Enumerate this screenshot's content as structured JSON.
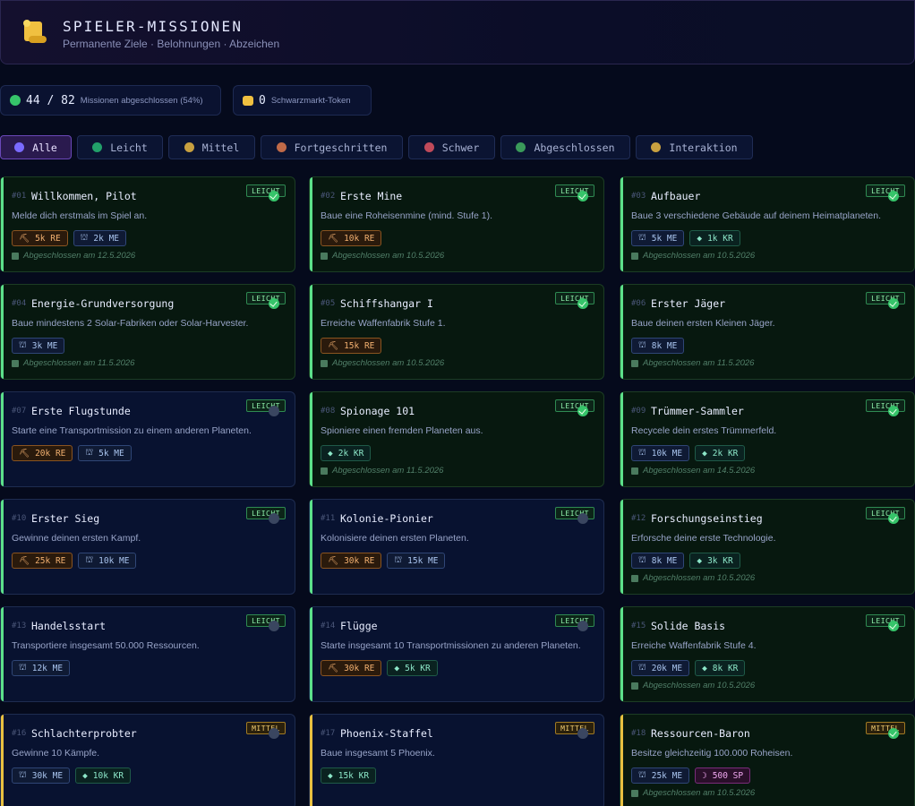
{
  "header": {
    "title": "SPIELER-MISSIONEN",
    "subtitle": "Permanente Ziele · Belohnungen · Abzeichen"
  },
  "stats": {
    "completed_value": "44 / 82",
    "completed_label": "Missionen abgeschlossen (54%)",
    "tokens_value": "0",
    "tokens_label": "Schwarzmarkt-Token"
  },
  "filters": [
    {
      "label": "Alle",
      "color": "#7a6aff"
    },
    {
      "label": "Leicht",
      "color": "#22a06a"
    },
    {
      "label": "Mittel",
      "color": "#c8a040"
    },
    {
      "label": "Fortgeschritten",
      "color": "#c06a48"
    },
    {
      "label": "Schwer",
      "color": "#c04a5a"
    },
    {
      "label": "Abgeschlossen",
      "color": "#3a9a5a"
    },
    {
      "label": "Interaktion",
      "color": "#c8a040"
    }
  ],
  "colors": {
    "leicht": "#5ce08a",
    "mittel": "#e8c040",
    "re": "#f2b070",
    "me": "#a9c4ee",
    "kr": "#8ce6c8",
    "sp": "#f0a8f0"
  },
  "missions": [
    {
      "id": "#01",
      "title": "Willkommen, Pilot",
      "desc": "Melde dich erstmals im Spiel an.",
      "badge": "LEICHT",
      "done": true,
      "rewards": [
        {
          "t": "re",
          "v": "5k RE"
        },
        {
          "t": "me",
          "v": "2k ME"
        }
      ],
      "completed": "Abgeschlossen am 12.5.2026"
    },
    {
      "id": "#02",
      "title": "Erste Mine",
      "desc": "Baue eine Roheisenmine (mind. Stufe 1).",
      "badge": "LEICHT",
      "done": true,
      "rewards": [
        {
          "t": "re",
          "v": "10k RE"
        }
      ],
      "completed": "Abgeschlossen am 10.5.2026"
    },
    {
      "id": "#03",
      "title": "Aufbauer",
      "desc": "Baue 3 verschiedene Gebäude auf deinem Heimatplaneten.",
      "badge": "LEICHT",
      "done": true,
      "rewards": [
        {
          "t": "me",
          "v": "5k ME"
        },
        {
          "t": "kr",
          "v": "1k KR"
        }
      ],
      "completed": "Abgeschlossen am 10.5.2026"
    },
    {
      "id": "#04",
      "title": "Energie-Grundversorgung",
      "desc": "Baue mindestens 2 Solar-Fabriken oder Solar-Harvester.",
      "badge": "LEICHT",
      "done": true,
      "rewards": [
        {
          "t": "me",
          "v": "3k ME"
        }
      ],
      "completed": "Abgeschlossen am 11.5.2026"
    },
    {
      "id": "#05",
      "title": "Schiffshangar I",
      "desc": "Erreiche Waffenfabrik Stufe 1.",
      "badge": "LEICHT",
      "done": true,
      "rewards": [
        {
          "t": "re",
          "v": "15k RE"
        }
      ],
      "completed": "Abgeschlossen am 10.5.2026"
    },
    {
      "id": "#06",
      "title": "Erster Jäger",
      "desc": "Baue deinen ersten Kleinen Jäger.",
      "badge": "LEICHT",
      "done": true,
      "rewards": [
        {
          "t": "me",
          "v": "8k ME"
        }
      ],
      "completed": "Abgeschlossen am 11.5.2026"
    },
    {
      "id": "#07",
      "title": "Erste Flugstunde",
      "desc": "Starte eine Transportmission zu einem anderen Planeten.",
      "badge": "LEICHT",
      "done": false,
      "rewards": [
        {
          "t": "re",
          "v": "20k RE"
        },
        {
          "t": "me",
          "v": "5k ME"
        }
      ],
      "completed": ""
    },
    {
      "id": "#08",
      "title": "Spionage 101",
      "desc": "Spioniere einen fremden Planeten aus.",
      "badge": "LEICHT",
      "done": true,
      "rewards": [
        {
          "t": "kr",
          "v": "2k KR"
        }
      ],
      "completed": "Abgeschlossen am 11.5.2026"
    },
    {
      "id": "#09",
      "title": "Trümmer-Sammler",
      "desc": "Recycele dein erstes Trümmerfeld.",
      "badge": "LEICHT",
      "done": true,
      "rewards": [
        {
          "t": "me",
          "v": "10k ME"
        },
        {
          "t": "kr",
          "v": "2k KR"
        }
      ],
      "completed": "Abgeschlossen am 14.5.2026"
    },
    {
      "id": "#10",
      "title": "Erster Sieg",
      "desc": "Gewinne deinen ersten Kampf.",
      "badge": "LEICHT",
      "done": false,
      "rewards": [
        {
          "t": "re",
          "v": "25k RE"
        },
        {
          "t": "me",
          "v": "10k ME"
        }
      ],
      "completed": ""
    },
    {
      "id": "#11",
      "title": "Kolonie-Pionier",
      "desc": "Kolonisiere deinen ersten Planeten.",
      "badge": "LEICHT",
      "done": false,
      "rewards": [
        {
          "t": "re",
          "v": "30k RE"
        },
        {
          "t": "me",
          "v": "15k ME"
        }
      ],
      "completed": ""
    },
    {
      "id": "#12",
      "title": "Forschungseinstieg",
      "desc": "Erforsche deine erste Technologie.",
      "badge": "LEICHT",
      "done": true,
      "rewards": [
        {
          "t": "me",
          "v": "8k ME"
        },
        {
          "t": "kr",
          "v": "3k KR"
        }
      ],
      "completed": "Abgeschlossen am 10.5.2026"
    },
    {
      "id": "#13",
      "title": "Handelsstart",
      "desc": "Transportiere insgesamt 50.000 Ressourcen.",
      "badge": "LEICHT",
      "done": false,
      "rewards": [
        {
          "t": "me",
          "v": "12k ME"
        }
      ],
      "completed": ""
    },
    {
      "id": "#14",
      "title": "Flügge",
      "desc": "Starte insgesamt 10 Transportmissionen zu anderen Planeten.",
      "badge": "LEICHT",
      "done": false,
      "rewards": [
        {
          "t": "re",
          "v": "30k RE"
        },
        {
          "t": "kr",
          "v": "5k KR"
        }
      ],
      "completed": ""
    },
    {
      "id": "#15",
      "title": "Solide Basis",
      "desc": "Erreiche Waffenfabrik Stufe 4.",
      "badge": "LEICHT",
      "done": true,
      "rewards": [
        {
          "t": "me",
          "v": "20k ME"
        },
        {
          "t": "kr",
          "v": "8k KR"
        }
      ],
      "completed": "Abgeschlossen am 10.5.2026"
    },
    {
      "id": "#16",
      "title": "Schlachterprobter",
      "desc": "Gewinne 10 Kämpfe.",
      "badge": "MITTEL",
      "done": false,
      "rewards": [
        {
          "t": "me",
          "v": "30k ME"
        },
        {
          "t": "kr",
          "v": "10k KR"
        }
      ],
      "completed": ""
    },
    {
      "id": "#17",
      "title": "Phoenix-Staffel",
      "desc": "Baue insgesamt 5 Phoenix.",
      "badge": "MITTEL",
      "done": false,
      "rewards": [
        {
          "t": "kr",
          "v": "15k KR"
        }
      ],
      "completed": ""
    },
    {
      "id": "#18",
      "title": "Ressourcen-Baron",
      "desc": "Besitze gleichzeitig 100.000 Roheisen.",
      "badge": "MITTEL",
      "done": true,
      "rewards": [
        {
          "t": "me",
          "v": "25k ME"
        },
        {
          "t": "sp",
          "v": "500 SP"
        }
      ],
      "completed": "Abgeschlossen am 10.5.2026"
    }
  ]
}
